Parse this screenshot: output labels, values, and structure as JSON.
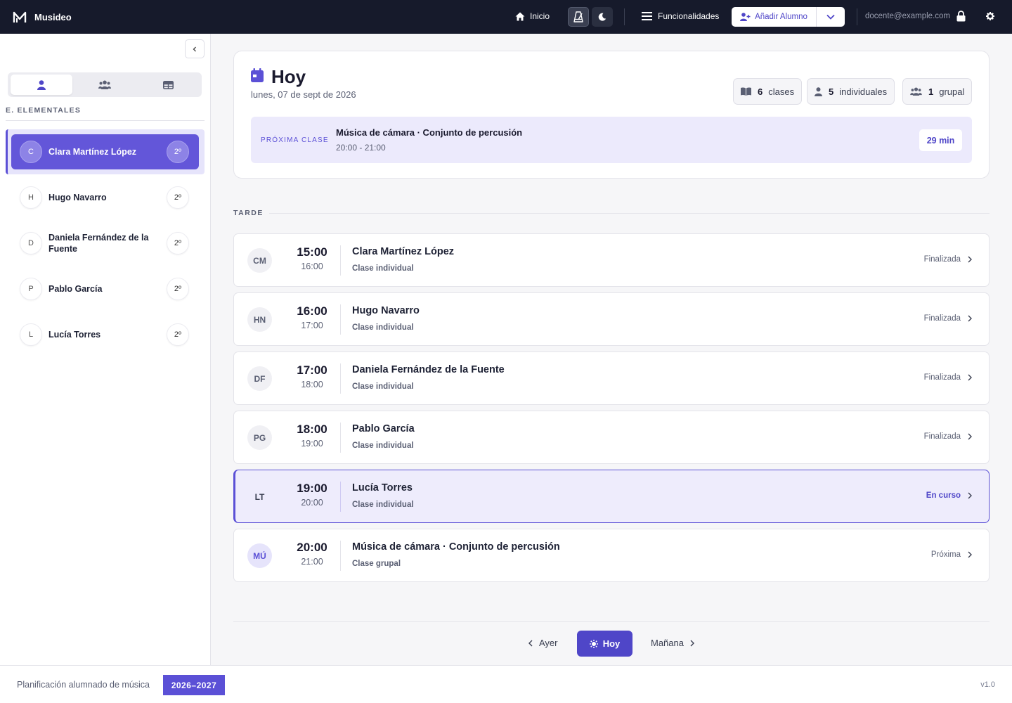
{
  "app": {
    "name": "Musideo"
  },
  "topbar": {
    "home_label": "Inicio",
    "features_label": "Funcionalidades",
    "add_student_label": "Añadir Alumno",
    "user_email": "docente@example.com"
  },
  "sidebar": {
    "section_title": "E. ELEMENTALES",
    "students": [
      {
        "initial": "C",
        "name": "Clara Martínez López",
        "grade": "2º",
        "selected": true
      },
      {
        "initial": "H",
        "name": "Hugo Navarro",
        "grade": "2º"
      },
      {
        "initial": "D",
        "name": "Daniela Fernández de la Fuente",
        "grade": "2º"
      },
      {
        "initial": "P",
        "name": "Pablo García",
        "grade": "2º"
      },
      {
        "initial": "L",
        "name": "Lucía Torres",
        "grade": "2º"
      }
    ]
  },
  "today": {
    "title": "Hoy",
    "date": "lunes, 07 de sept de 2026",
    "stats": {
      "classes_count": "6",
      "classes_label": "clases",
      "individual_count": "5",
      "individual_label": "individuales",
      "group_count": "1",
      "group_label": "grupal"
    },
    "next_class": {
      "label": "PRÓXIMA CLASE",
      "title": "Música de cámara · Conjunto de percusión",
      "time": "20:00 - 21:00",
      "remaining": "29 min"
    }
  },
  "schedule": {
    "section": "TARDE",
    "classes": [
      {
        "initials": "CM",
        "start": "15:00",
        "end": "16:00",
        "name": "Clara Martínez López",
        "type": "Clase individual",
        "status": "Finalizada"
      },
      {
        "initials": "HN",
        "start": "16:00",
        "end": "17:00",
        "name": "Hugo Navarro",
        "type": "Clase individual",
        "status": "Finalizada"
      },
      {
        "initials": "DF",
        "start": "17:00",
        "end": "18:00",
        "name": "Daniela Fernández de la Fuente",
        "type": "Clase individual",
        "status": "Finalizada"
      },
      {
        "initials": "PG",
        "start": "18:00",
        "end": "19:00",
        "name": "Pablo García",
        "type": "Clase individual",
        "status": "Finalizada"
      },
      {
        "initials": "LT",
        "start": "19:00",
        "end": "20:00",
        "name": "Lucía Torres",
        "type": "Clase individual",
        "status": "En curso"
      },
      {
        "initials": "MÚ",
        "start": "20:00",
        "end": "21:00",
        "name": "Música de cámara · Conjunto de percusión",
        "type": "Clase grupal",
        "status": "Próxima"
      }
    ]
  },
  "pager": {
    "prev": "Ayer",
    "today": "Hoy",
    "next": "Mañana"
  },
  "footer": {
    "text": "Planificación alumnado de música",
    "year": "2026–2027",
    "version": "v1.0"
  },
  "colors": {
    "accent": "#5b50d6",
    "topbar_bg": "#161a2b",
    "current_bg": "#eeecfc"
  },
  "icons": {
    "logo": "m-logo-icon",
    "home": "home-icon",
    "metronome": "metronome-icon",
    "theme": "moon-icon",
    "features": "menu-icon",
    "add_student": "user-plus-icon",
    "dropdown": "chevron-down-icon",
    "lock": "lock-icon",
    "settings": "gear-icon",
    "calendar": "calendar-icon"
  }
}
